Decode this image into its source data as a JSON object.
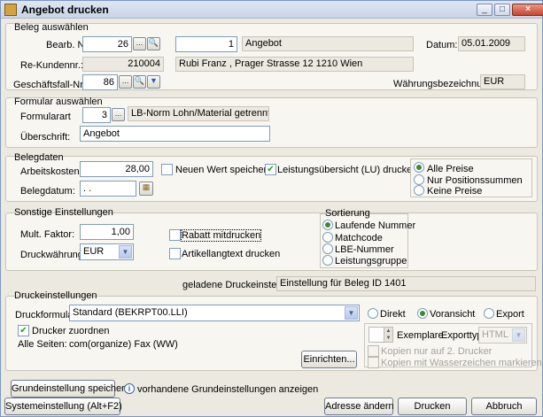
{
  "window": {
    "title": "Angebot drucken",
    "min_glyph": "_",
    "max_glyph": "□",
    "close_glyph": "×"
  },
  "beleg": {
    "legend": "Beleg auswählen",
    "bearb_label": "Bearb. Nr.:",
    "bearb_value": "26",
    "doc_number": "1",
    "doc_type": "Angebot",
    "datum_label": "Datum:",
    "datum_value": "05.01.2009",
    "kunde_label": "Re-Kundennr.:",
    "kunde_value": "210004",
    "kunde_address": "Rubi Franz  , Prager Strasse 12 1210  Wien",
    "geschaeft_label": "Geschäftsfall-Nr.:",
    "geschaeft_value": "86",
    "waehrung_label": "Währungsbezeichnung:",
    "waehrung_value": "EUR"
  },
  "formular": {
    "legend": "Formular auswählen",
    "art_label": "Formularart",
    "art_value": "3",
    "art_desc": "LB-Norm Lohn/Material getrennt",
    "ueberschrift_label": "Überschrift:",
    "ueberschrift_value": "Angebot"
  },
  "belegdaten": {
    "legend": "Belegdaten",
    "arbeitskosten_label": "Arbeitskosten:",
    "arbeitskosten_value": "28,00",
    "neuer_wert_label": "Neuen Wert speichern",
    "neuer_wert_checked": false,
    "leistungs_label": "Leistungsübersicht (LU) drucken",
    "leistungs_checked": true,
    "belegdatum_label": "Belegdatum:",
    "belegdatum_value": " .  .",
    "preise_options": [
      "Alle Preise",
      "Nur Positionssummen",
      "Keine Preise"
    ],
    "preise_selected": 0
  },
  "sonstige": {
    "legend": "Sonstige Einstellungen",
    "faktor_label": "Mult. Faktor:",
    "faktor_value": "1,00",
    "druckwaehrung_label": "Druckwährung:",
    "druckwaehrung_value": "EUR",
    "rabatt_label": "Rabatt mitdrucken",
    "rabatt_checked": false,
    "artikellang_label": "Artikellangtext drucken",
    "artikellang_checked": false
  },
  "sortierung": {
    "legend": "Sortierung",
    "options": [
      "Laufende Nummer",
      "Matchcode",
      "LBE-Nummer",
      "Leistungsgruppe"
    ],
    "selected": 0
  },
  "geladene": {
    "label": "geladene Druckeinstellung:",
    "value": "Einstellung für Beleg ID 1401"
  },
  "druck": {
    "legend": "Druckeinstellungen",
    "formular_label": "Druckformular:",
    "formular_value": "Standard (BEKRPT00.LLI)",
    "modes": [
      "Direkt",
      "Voransicht",
      "Export"
    ],
    "mode_selected": 1,
    "drucker_zuordnen_label": "Drucker zuordnen",
    "drucker_zuordnen_checked": true,
    "alle_seiten_label": "Alle Seiten:",
    "alle_seiten_value": "com(organize) Fax (WW)",
    "einrichten_label": "Einrichten...",
    "exemplare_label": "Exemplare",
    "exporttyp_label": "Exporttyp:",
    "exporttyp_value": "HTML",
    "kopien_2_label": "Kopien nur auf 2. Drucker",
    "kopien_wasser_label": "Kopien mit Wasserzeichen markieren"
  },
  "footer": {
    "grundeinstellung_label": "Grundeinstellung speichern",
    "vorhandene_label": "vorhandene Grundeinstellungen anzeigen",
    "system_label": "Systemeinstellung (Alt+F2)",
    "adresse_label": "Adresse ändern",
    "drucken_label": "Drucken",
    "abbruch_label": "Abbruch"
  },
  "icons": {
    "ellipsis": "...",
    "search": "🔍",
    "down": "▼",
    "check": "✔",
    "calendar": "▦",
    "spin_up": "▲",
    "spin_down": "▼"
  }
}
